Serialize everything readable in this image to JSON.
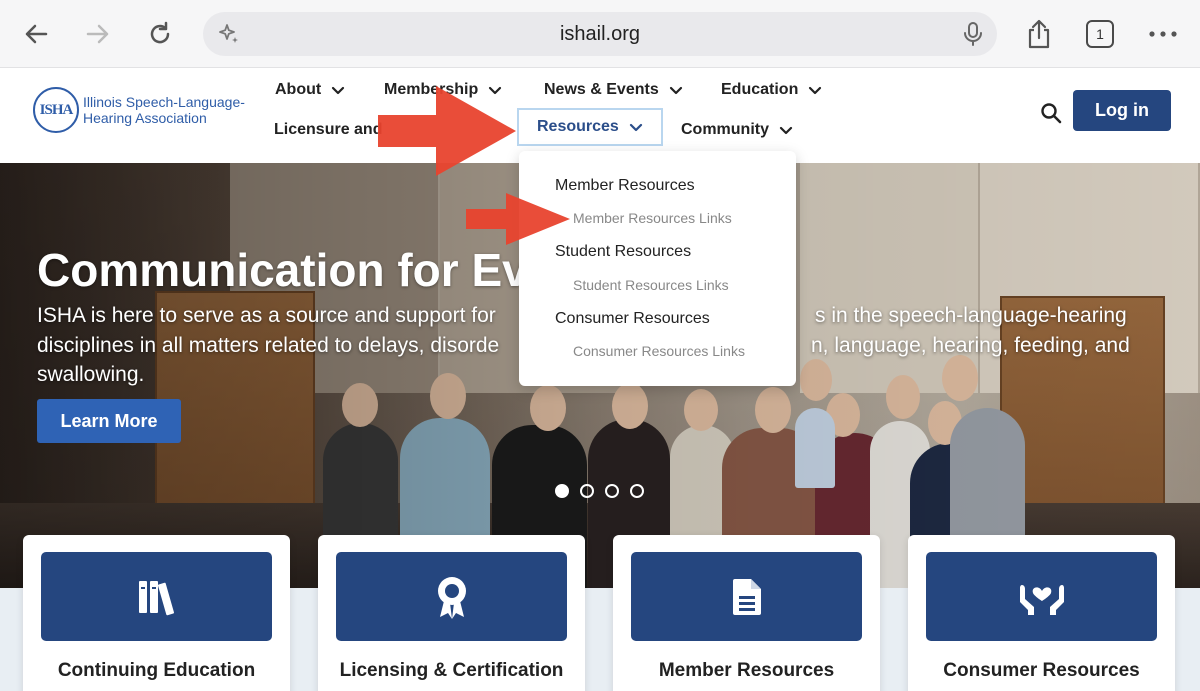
{
  "browser": {
    "url": "ishail.org",
    "tab_count": "1"
  },
  "header": {
    "logo_mark": "ISHA",
    "logo_line1": "Illinois Speech-Language-",
    "logo_line2": "Hearing Association",
    "menu": {
      "about": "About",
      "membership": "Membership",
      "news_events": "News & Events",
      "education": "Education",
      "licensure": "Licensure and",
      "resources": "Resources",
      "community": "Community"
    },
    "login_label": "Log in"
  },
  "dropdown": {
    "member_resources": "Member Resources",
    "member_resources_links": "Member Resources Links",
    "student_resources": "Student Resources",
    "student_resources_links": "Student Resources Links",
    "consumer_resources": "Consumer Resources",
    "consumer_resources_links": "Consumer Resources Links"
  },
  "hero": {
    "title": "Communication for Ever",
    "text_line1": "ISHA is here to serve as a source and support for",
    "text_line1_tail": "s in the speech-language-hearing",
    "text_line2": "disciplines in all matters related to delays, disorde",
    "text_line2_tail": "n, language, hearing, feeding, and",
    "text_line3": "swallowing.",
    "learn_more": "Learn More"
  },
  "cards": {
    "continuing_education": "Continuing Education",
    "licensing_certification": "Licensing & Certification",
    "member_resources": "Member Resources",
    "consumer_resources": "Consumer Resources"
  },
  "colors": {
    "brand_blue": "#25467f",
    "accent_blue": "#2f63b5",
    "annotation_red": "#e8432e"
  }
}
